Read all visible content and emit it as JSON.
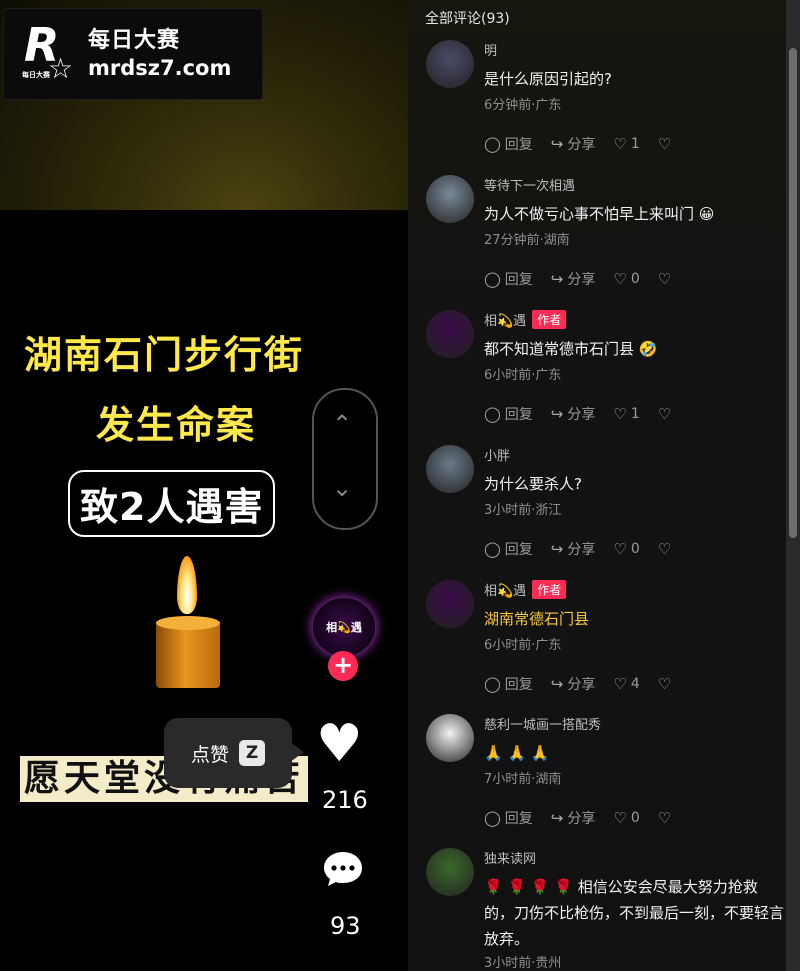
{
  "watermark": {
    "brand_cn": "每日大赛",
    "url": "mrdsz7.com",
    "logo_letter": "R",
    "logo_small": "每日大赛"
  },
  "video": {
    "title_line1": "湖南石门步行街",
    "title_line2": "发生命案",
    "title_line3": "致2人遇害",
    "subtitle": "愿天堂没有痛苦",
    "creator_avatar_text": "相💫遇",
    "follow_symbol": "+",
    "like_count": "216",
    "comment_count": "93",
    "tooltip_label": "点赞",
    "tooltip_key": "Z",
    "nav_up": "⌃",
    "nav_down": "⌄"
  },
  "comments_panel": {
    "header": "全部评论(93)",
    "action_reply": "回复",
    "action_share": "分享",
    "comments": [
      {
        "name": "明",
        "author": false,
        "text": "是什么原因引起的?",
        "meta": "6分钟前·广东",
        "likes": "1",
        "avatar_color": "#4b4b6a"
      },
      {
        "name": "等待下一次相遇",
        "author": false,
        "text": "为人不做亏心事不怕早上来叫门 😀",
        "meta": "27分钟前·湖南",
        "likes": "0",
        "avatar_color": "#7a8a9a"
      },
      {
        "name": "相💫遇",
        "author": true,
        "author_label": "作者",
        "text": "都不知道常德市石门县 🤣",
        "meta": "6小时前·广东",
        "likes": "1",
        "avatar_color": "#3a0a4a"
      },
      {
        "name": "小胖",
        "author": false,
        "text": "为什么要杀人?",
        "meta": "3小时前·浙江",
        "likes": "0",
        "avatar_color": "#6a7a8a"
      },
      {
        "name": "相💫遇",
        "author": true,
        "author_label": "作者",
        "text": "湖南常德石门县",
        "meta": "6小时前·广东",
        "likes": "4",
        "avatar_color": "#3a0a4a",
        "link": true
      },
      {
        "name": "慈利一城画一搭配秀",
        "author": false,
        "text": "🙏 🙏 🙏",
        "meta": "7小时前·湖南",
        "likes": "0",
        "avatar_color": "#f2f2f2"
      },
      {
        "name": "独来读网",
        "author": false,
        "text": "🌹 🌹 🌹 🌹 相信公安会尽最大努力抢救的，刀伤不比枪伤，不到最后一刻，不要轻言放弃。",
        "meta": "3小时前·贵州",
        "likes": "",
        "avatar_color": "#3a6a2a"
      }
    ]
  }
}
